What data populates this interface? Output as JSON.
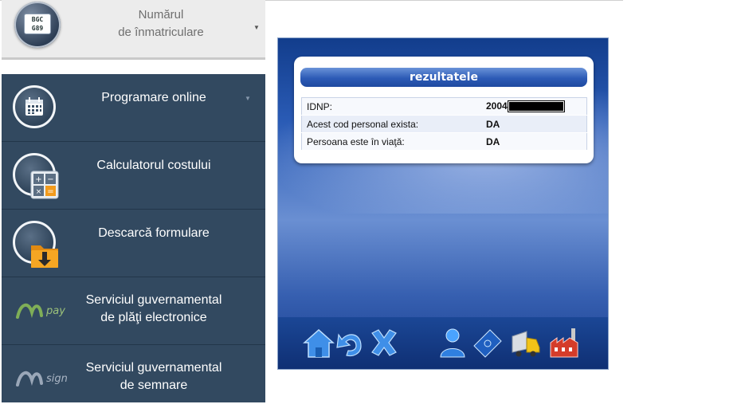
{
  "plate_selector": {
    "title_line1": "Numărul",
    "title_line2": "de înmatriculare",
    "plate_line1": "BGC",
    "plate_line2": "G89",
    "icon": "license-plate-icon",
    "arrow_icon": "caret-down-icon"
  },
  "sidebar": {
    "items": [
      {
        "label": "Programare online",
        "icon": "calendar-icon",
        "has_dropdown": true
      },
      {
        "label": "Calculatorul costului",
        "icon": "calculator-icon"
      },
      {
        "label": "Descarcă formulare",
        "icon": "folder-download-icon"
      },
      {
        "label_line1": "Serviciul guvernamental",
        "label_line2": "de plăţi electronice",
        "icon": "mpay-logo",
        "logo_text": "pay"
      },
      {
        "label_line1": "Serviciul guvernamental",
        "label_line2": "de semnare",
        "icon": "msign-logo",
        "logo_text": "sign"
      }
    ]
  },
  "results": {
    "title": "rezultatele",
    "rows": [
      {
        "label": "IDNP:",
        "value": "2004",
        "redacted": true
      },
      {
        "label": "Acest cod personal exista:",
        "value": "DA"
      },
      {
        "label": "Persoana este în viaţă:",
        "value": "DA"
      }
    ]
  },
  "toolbar": {
    "icons": [
      "home-icon",
      "back-arrow-icon",
      "close-x-icon",
      "person-icon",
      "passport-icon",
      "truck-icon",
      "factory-icon"
    ]
  },
  "colors": {
    "sidebar_bg": "#324960",
    "window_blue": "#2a5bb5",
    "title_bar_blue": "#2d5bb6"
  }
}
